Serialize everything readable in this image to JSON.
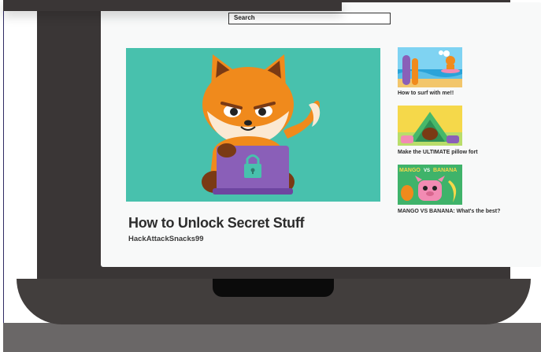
{
  "search": {
    "placeholder": "Search"
  },
  "main_video": {
    "title": "How to Unlock Secret Stuff",
    "channel": "HackAttackSnacks99"
  },
  "recommended": [
    {
      "title": "How to surf with me!!",
      "thumbnail_icon": "surfing-scene-thumbnail"
    },
    {
      "title": "Make the ULTIMATE pillow fort",
      "thumbnail_icon": "pillow-fort-thumbnail"
    },
    {
      "title": "MANGO VS BANANA: What's the best?",
      "thumbnail_icon": "mango-vs-banana-thumbnail",
      "thumbnail_text_a": "MANGO",
      "thumbnail_text_vs": "VS",
      "thumbnail_text_b": "BANANA"
    }
  ],
  "colors": {
    "hero_bg": "#48c1ad",
    "laptop_body": "#423e3d",
    "bezel": "#3a3636",
    "screen_bg": "#f8f9f9"
  }
}
